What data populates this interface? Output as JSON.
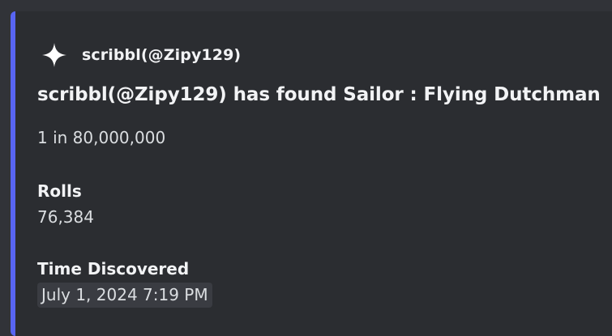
{
  "embed": {
    "accent_color": "#5865f2",
    "author": {
      "icon": "four-point-sparkle-icon",
      "name": "scribbl(@Zipy129)"
    },
    "title": "scribbl(@Zipy129) has found Sailor : Flying Dutchman",
    "description": "1 in 80,000,000",
    "fields": [
      {
        "name": "Rolls",
        "value": "76,384"
      },
      {
        "name": "Time Discovered",
        "value": "July 1, 2024 7:19 PM"
      }
    ]
  }
}
